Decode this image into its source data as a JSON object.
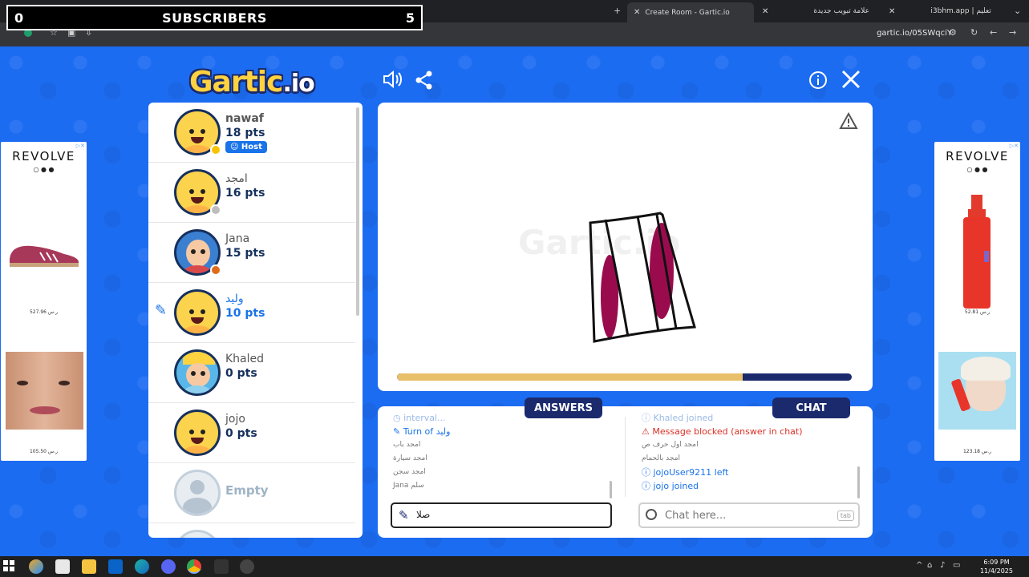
{
  "overlay": {
    "left_count": "0",
    "label": "SUBSCRIBERS",
    "right_count": "5"
  },
  "browser": {
    "tabs": [
      {
        "label": "Create Room - Gartic.io"
      },
      {
        "label": "علامة تبويب جديدة"
      },
      {
        "label": "i3bhm.app | تعليم"
      }
    ],
    "url": "gartic.io/05SWqciY"
  },
  "game": {
    "logo_main": "Gartic",
    "logo_suffix": ".io",
    "watermark": "Gartic.io"
  },
  "players": [
    {
      "name": "nawaf",
      "points": "18 pts",
      "badge": "Host",
      "dot_color": "#f6c300"
    },
    {
      "name": "امجد",
      "points": "16 pts",
      "dot_color": "#bdbdbd"
    },
    {
      "name": "Jana",
      "points": "15 pts",
      "dot_color": "#e06b1a"
    },
    {
      "name": "وليد",
      "points": "10 pts",
      "drawing": true
    },
    {
      "name": "Khaled",
      "points": "0 pts"
    },
    {
      "name": "jojo",
      "points": "0 pts"
    },
    {
      "name": "Empty"
    }
  ],
  "canvas": {
    "progress_fraction": 0.76
  },
  "answers": {
    "tab_label": "ANSWERS",
    "lines": [
      {
        "text": "interval..."
      },
      {
        "text": "Turn of وليد"
      },
      {
        "text": "امجد باب"
      },
      {
        "text": "امجد سيارة"
      },
      {
        "text": "امجد سجن"
      },
      {
        "text": "Jana سلم"
      }
    ],
    "input_value": "صلا"
  },
  "chat": {
    "tab_label": "CHAT",
    "lines": [
      {
        "text": "Khaled joined"
      },
      {
        "text": "Message blocked (answer in chat)"
      },
      {
        "text": "امجد اول حرف ص"
      },
      {
        "text": "امجد بالحمام"
      },
      {
        "text": "jojoUser9211 left"
      },
      {
        "text": "jojo joined"
      }
    ],
    "placeholder": "Chat here...",
    "tab_hint": "tab"
  },
  "ads": {
    "brand": "REVOLVE",
    "left_prices": [
      "527.96 ر.س",
      "105.50 ر.س"
    ],
    "right_prices": [
      "52.81 ر.س",
      "123.18 ر.س"
    ]
  },
  "taskbar": {
    "time": "6:09 PM",
    "date": "11/4/2025"
  },
  "colors": {
    "accent": "#1a2a6c",
    "link": "#1a73e8",
    "bg": "#1c6cf2",
    "progress": "#e8c06a"
  }
}
